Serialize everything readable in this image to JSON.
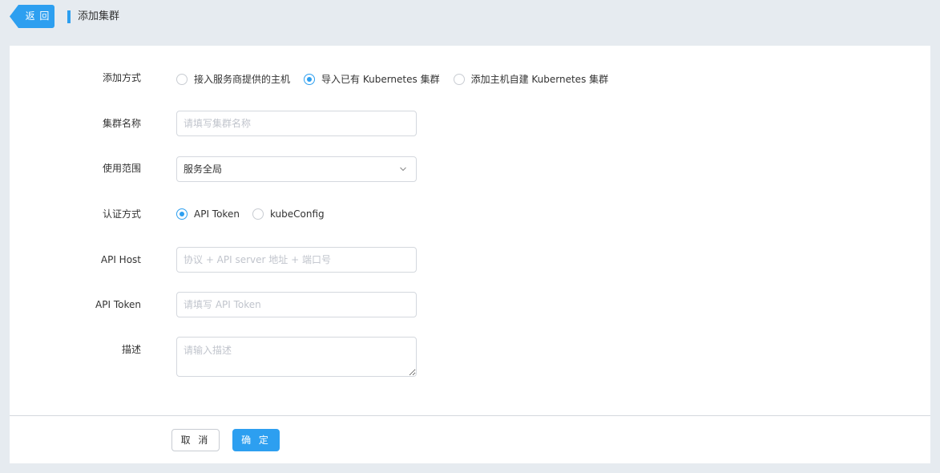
{
  "header": {
    "back_label": "返 回",
    "page_title": "添加集群"
  },
  "form": {
    "add_method": {
      "label": "添加方式",
      "options": [
        {
          "label": "接入服务商提供的主机",
          "checked": false
        },
        {
          "label": "导入已有 Kubernetes 集群",
          "checked": true
        },
        {
          "label": "添加主机自建 Kubernetes 集群",
          "checked": false
        }
      ]
    },
    "cluster_name": {
      "label": "集群名称",
      "placeholder": "请填写集群名称",
      "value": ""
    },
    "scope": {
      "label": "使用范围",
      "value": "服务全局"
    },
    "auth_method": {
      "label": "认证方式",
      "options": [
        {
          "label": "API Token",
          "checked": true
        },
        {
          "label": "kubeConfig",
          "checked": false
        }
      ]
    },
    "api_host": {
      "label": "API Host",
      "placeholder": "协议 + API server 地址 + 端口号",
      "value": ""
    },
    "api_token": {
      "label": "API Token",
      "placeholder": "请填写 API Token",
      "value": ""
    },
    "description": {
      "label": "描述",
      "placeholder": "请输入描述",
      "value": ""
    }
  },
  "footer": {
    "cancel_label": "取 消",
    "confirm_label": "确 定"
  },
  "colors": {
    "accent": "#2d9ff0",
    "page_background": "#e6ebf0",
    "border": "#d4d8de"
  }
}
